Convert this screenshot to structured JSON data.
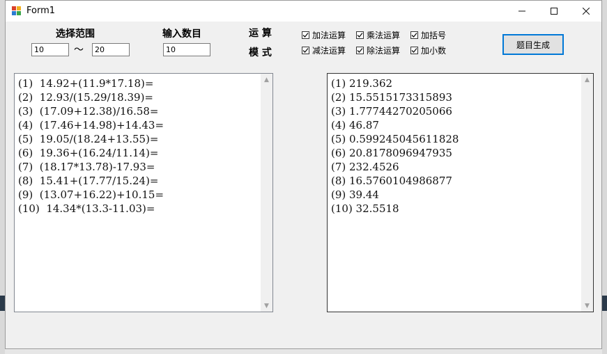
{
  "window": {
    "title": "Form1",
    "minimize": "–",
    "maximize": "☐",
    "close": "✕"
  },
  "range": {
    "label": "选择范围",
    "min": "10",
    "separator": "～",
    "max": "20"
  },
  "count": {
    "label": "输入数目",
    "value": "10"
  },
  "mode": {
    "line1": "运 算",
    "line2": "模 式"
  },
  "options": [
    {
      "label": "加法运算",
      "checked": true
    },
    {
      "label": "乘法运算",
      "checked": true
    },
    {
      "label": "加括号",
      "checked": true
    },
    {
      "label": "减法运算",
      "checked": true
    },
    {
      "label": "除法运算",
      "checked": true
    },
    {
      "label": "加小数",
      "checked": true
    }
  ],
  "generate_button": "题目生成",
  "questions": [
    "(1)  14.92+(11.9*17.18)=",
    "(2)  12.93/(15.29/18.39)=",
    "(3)  (17.09+12.38)/16.58=",
    "(4)  (17.46+14.98)+14.43=",
    "(5)  19.05/(18.24+13.55)=",
    "(6)  19.36+(16.24/11.14)=",
    "(7)  (18.17*13.78)-17.93=",
    "(8)  15.41+(17.77/15.24)=",
    "(9)  (13.07+16.22)+10.15=",
    "(10)  14.34*(13.3-11.03)="
  ],
  "answers": [
    "(1) 219.362",
    "(2) 15.5515173315893",
    "(3) 1.77744270205066",
    "(4) 46.87",
    "(5) 0.599245045611828",
    "(6) 20.8178096947935",
    "(7) 232.4526",
    "(8) 16.5760104986877",
    "(9) 39.44",
    "(10) 32.5518"
  ]
}
